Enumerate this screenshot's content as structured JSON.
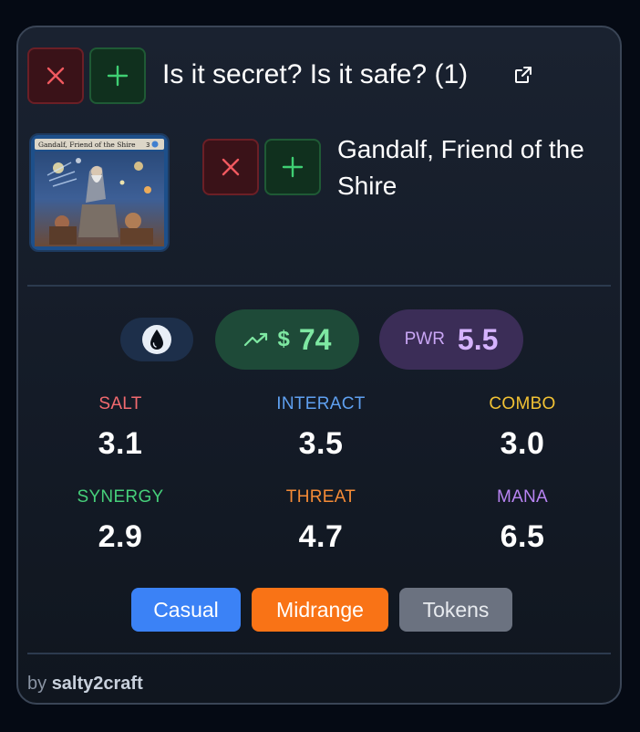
{
  "header": {
    "title": "Is it secret? Is it safe? (1)",
    "remove_icon": "close-icon",
    "add_icon": "plus-icon",
    "external_icon": "external-link-icon"
  },
  "card": {
    "name": "Gandalf, Friend of the Shire",
    "thumb_title": "Gandalf, Friend of the Shire",
    "thumb_cost": "3",
    "remove_icon": "close-icon",
    "add_icon": "plus-icon"
  },
  "badges": {
    "color_icon": "blue-mana-drop-icon",
    "price_icon": "trending-up-icon",
    "price_symbol": "$",
    "price_value": "74",
    "power_label": "PWR",
    "power_value": "5.5"
  },
  "stats": [
    {
      "label": "SALT",
      "value": "3.1",
      "color": "#f26a6f"
    },
    {
      "label": "INTERACT",
      "value": "3.5",
      "color": "#5fa0f0"
    },
    {
      "label": "COMBO",
      "value": "3.0",
      "color": "#f2c234"
    },
    {
      "label": "SYNERGY",
      "value": "2.9",
      "color": "#46cf7a"
    },
    {
      "label": "THREAT",
      "value": "4.7",
      "color": "#f58b36"
    },
    {
      "label": "MANA",
      "value": "6.5",
      "color": "#b884f2"
    }
  ],
  "tags": [
    "Casual",
    "Midrange",
    "Tokens"
  ],
  "colors": {
    "casual": "#3b82f6",
    "midrange": "#f97316",
    "tokens": "#6b7280",
    "price_green": "#7ee8a2",
    "power_purple": "#d6b3ff"
  },
  "footer": {
    "by": "by",
    "author": "salty2craft"
  }
}
